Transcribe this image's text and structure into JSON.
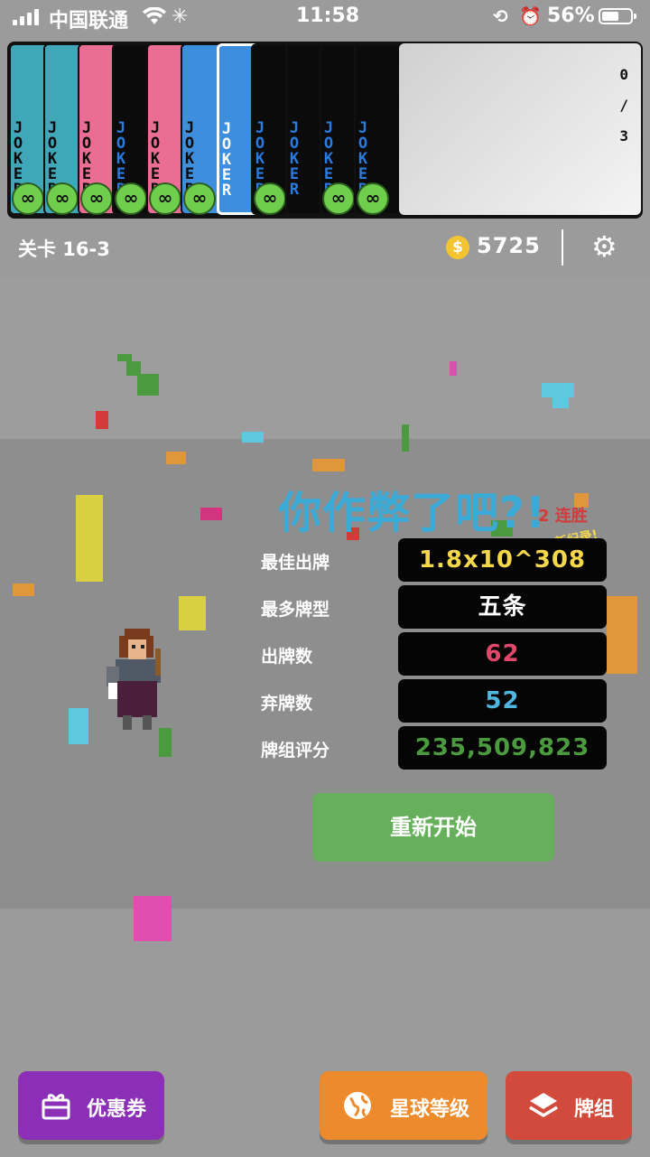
{
  "status_bar": {
    "carrier": "中国联通",
    "time": "11:58",
    "battery_pct": "56%"
  },
  "card_strip": {
    "joker_text": "JOKER",
    "infinity_badge": "∞",
    "count_top": "0",
    "count_sep": "/",
    "count_total": "3",
    "cards": [
      {
        "color": "#3fa7b8",
        "dark": false,
        "badge": true
      },
      {
        "color": "#3fa7b8",
        "dark": false,
        "badge": true
      },
      {
        "color": "#ea6d93",
        "dark": false,
        "badge": true
      },
      {
        "color": "#0b0b0b",
        "dark": true,
        "badge": true
      },
      {
        "color": "#ea6d93",
        "dark": false,
        "badge": true
      },
      {
        "color": "#3d8fde",
        "dark": false,
        "badge": true
      },
      {
        "color": "#3d8fde",
        "dark": false,
        "badge": false,
        "selected": true
      },
      {
        "color": "#0b0b0b",
        "dark": true,
        "badge": true
      },
      {
        "color": "#0b0b0b",
        "dark": true,
        "badge": false
      },
      {
        "color": "#0b0b0b",
        "dark": true,
        "badge": true
      },
      {
        "color": "#0b0b0b",
        "dark": true,
        "badge": true
      }
    ]
  },
  "top_bar": {
    "level": "关卡 16-3",
    "coin_symbol": "$",
    "coins": "5725",
    "settings_icon": "gear-icon"
  },
  "result": {
    "title": "你作弊了吧?!",
    "streak": "2 连胜",
    "new_record": "新纪录!",
    "rows": [
      {
        "label": "最佳出牌",
        "value": "1.8x10^308",
        "color": "#f4d84a"
      },
      {
        "label": "最多牌型",
        "value": "五条",
        "color": "#ffffff"
      },
      {
        "label": "出牌数",
        "value": "62",
        "color": "#e0476b"
      },
      {
        "label": "弃牌数",
        "value": "52",
        "color": "#4fb6e0"
      },
      {
        "label": "牌组评分",
        "value": "235,509,823",
        "color": "#4c9a3f"
      }
    ],
    "restart": "重新开始"
  },
  "bottom_buttons": [
    {
      "label": "优惠券",
      "icon": "gift-icon",
      "color": "#8b2fb6"
    },
    {
      "label": "星球等级",
      "icon": "globe-icon",
      "color": "#ec8a2c"
    },
    {
      "label": "牌组",
      "icon": "layers-icon",
      "color": "#d24a3c"
    }
  ]
}
